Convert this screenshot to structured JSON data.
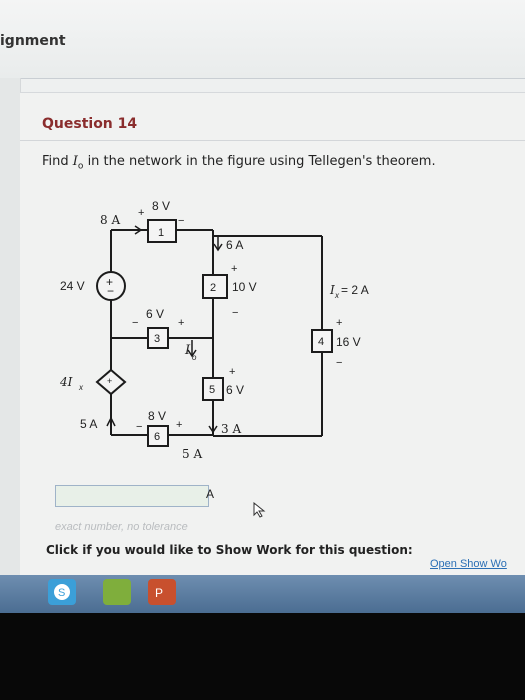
{
  "header": {
    "title": "ignment"
  },
  "question": {
    "title": "Question 14",
    "text_prefix": "Find ",
    "text_var": "I",
    "text_sub": "o",
    "text_suffix": " in the network in the figure using Tellegen's theorem."
  },
  "circuit": {
    "elements": [
      {
        "id": "1",
        "voltage": "8 V",
        "current": "8 A"
      },
      {
        "id": "2",
        "voltage": "10 V",
        "current": "6 A"
      },
      {
        "id": "3",
        "voltage": "6 V",
        "current": "I_o"
      },
      {
        "id": "4",
        "voltage": "16 V",
        "current": "I_x = 2 A"
      },
      {
        "id": "5",
        "voltage": "6 V",
        "current": "3 A"
      },
      {
        "id": "6",
        "voltage": "8 V",
        "current": "5 A"
      }
    ],
    "sources": [
      {
        "label": "24 V",
        "type": "voltage"
      },
      {
        "label": "4I_x",
        "type": "dependent-current",
        "current": "5 A"
      }
    ],
    "labels": {
      "v1": "8 V",
      "i1": "8 A",
      "plus": "+",
      "minus": "−",
      "v2": "10 V",
      "i2": "6 A",
      "v3": "6 V",
      "io_main": "I",
      "io_sub": "o",
      "v4": "16 V",
      "ix_main": "I",
      "ix_sub": "x",
      "ix_val": " = 2 A",
      "v5": "6 V",
      "i5": "3 A",
      "v6": "8 V",
      "i6": "5 A",
      "vs": "24 V",
      "cs_main": "4I",
      "cs_sub": "x",
      "cs_i": "5 A",
      "n1": "1",
      "n2": "2",
      "n3": "3",
      "n4": "4",
      "n5": "5",
      "n6": "6"
    }
  },
  "answer": {
    "value": "",
    "unit": "A",
    "hint": "exact number, no tolerance"
  },
  "showwork": {
    "label": "Click if you would like to Show Work for this question:",
    "link": "Open Show Wo"
  },
  "colors": {
    "question_title": "#8a2d2d",
    "link": "#2b6fb5",
    "taskbar": "#5a7ca2"
  },
  "taskbar": {
    "icons": [
      "skype-icon",
      "app-icon",
      "powerpoint-icon"
    ]
  }
}
